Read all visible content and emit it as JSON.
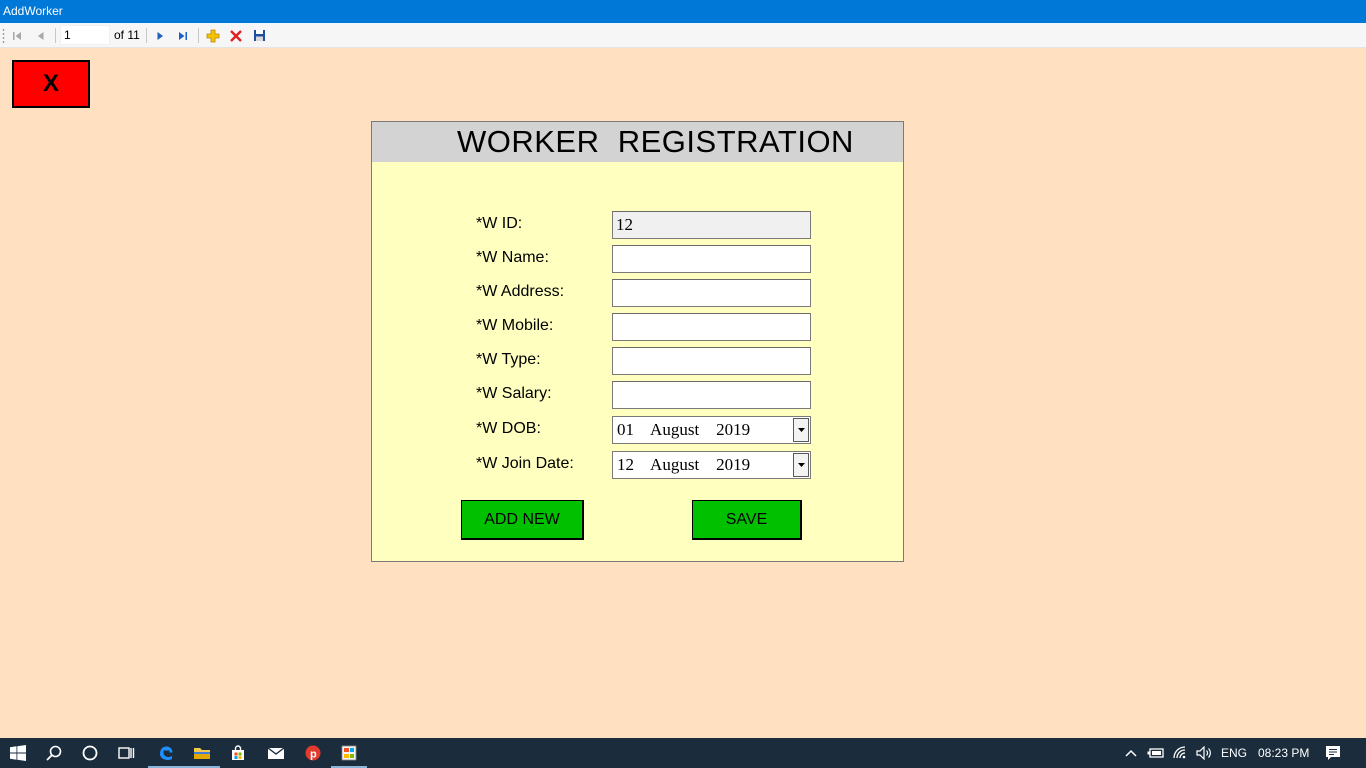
{
  "window": {
    "title": "AddWorker"
  },
  "navigator": {
    "position": "1",
    "count_label": "of 11",
    "buttons": [
      "move-first",
      "move-previous",
      "move-next",
      "move-last",
      "add-new",
      "delete",
      "save"
    ]
  },
  "close_button": {
    "label": "X",
    "color": "#FF0000"
  },
  "form": {
    "title": "WORKER  REGISTRATION",
    "fields": [
      {
        "label": "*W ID:",
        "value": "12",
        "readonly": true
      },
      {
        "label": "*W Name:",
        "value": ""
      },
      {
        "label": "*W Address:",
        "value": ""
      },
      {
        "label": "*W Mobile:",
        "value": ""
      },
      {
        "label": "*W Type:",
        "value": ""
      },
      {
        "label": "*W Salary:",
        "value": ""
      }
    ],
    "dob": {
      "label": "*W DOB:",
      "value": "01    August    2019"
    },
    "join_date": {
      "label": "*W Join Date:",
      "value": "12    August    2019"
    },
    "add_new_label": "ADD NEW",
    "save_label": "SAVE"
  },
  "colors": {
    "background": "#FFE0C0",
    "panel": "#FFFFC0",
    "header": "#D3D3D3",
    "button_green": "#00C000",
    "titlebar": "#0078D7"
  },
  "taskbar": {
    "icons": [
      "windows-start",
      "search",
      "cortana",
      "task-view",
      "edge",
      "file-explorer",
      "store",
      "mail",
      "vpn-app",
      "running-app"
    ],
    "tray": {
      "language": "ENG",
      "time": "08:23 PM"
    }
  }
}
